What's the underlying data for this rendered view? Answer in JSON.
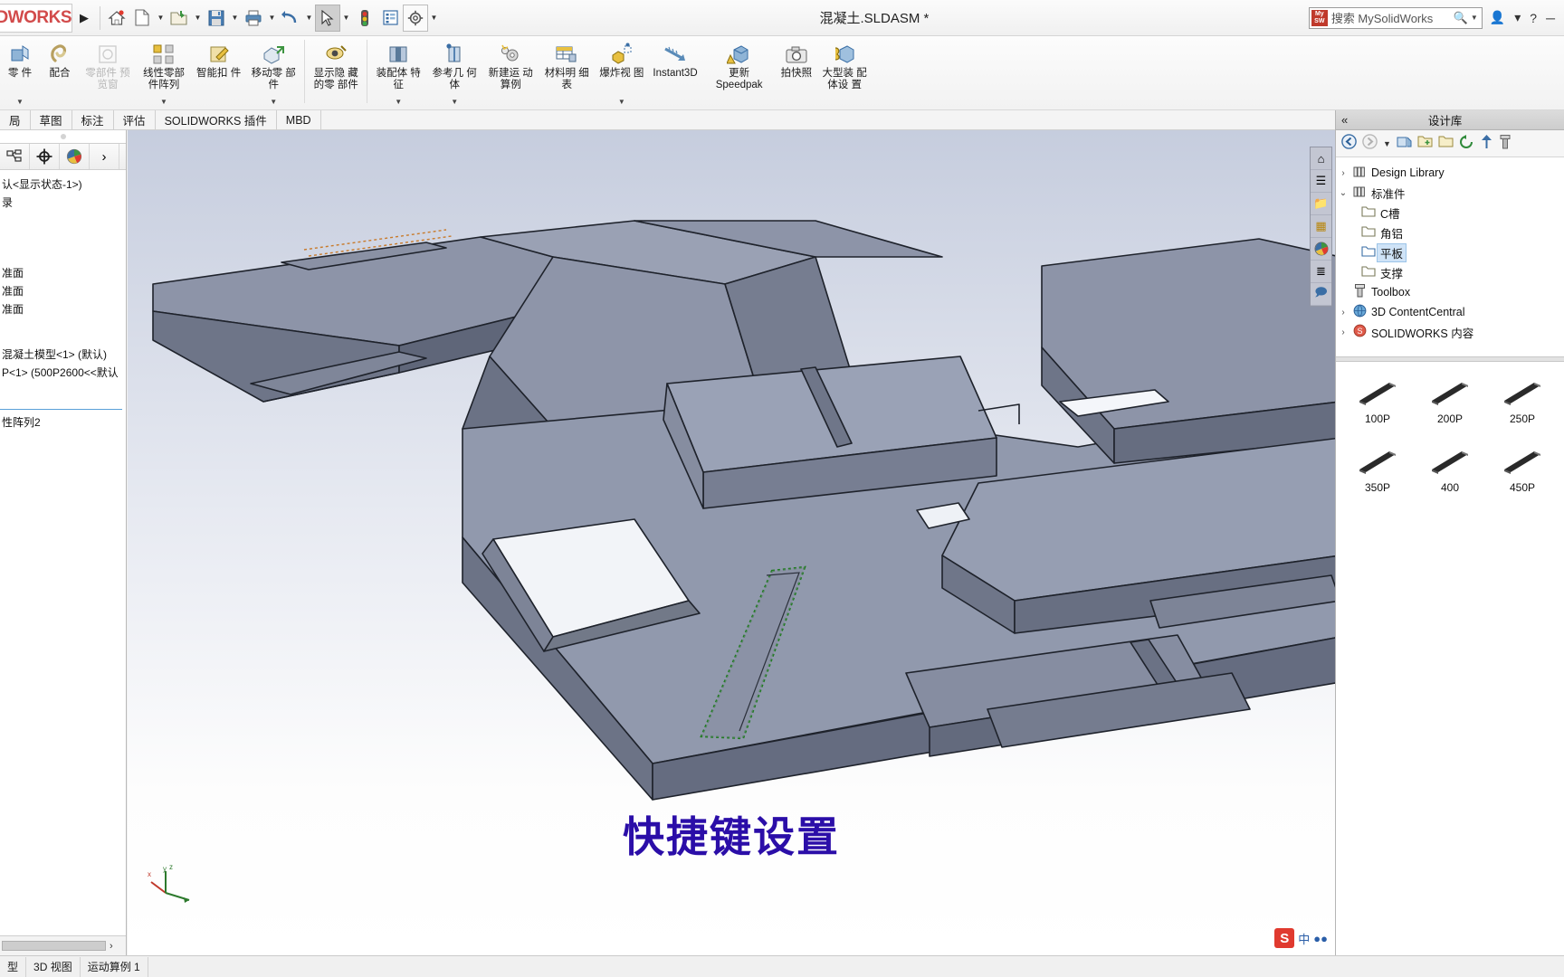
{
  "titlebar": {
    "logo": "DWORKS",
    "document_title": "混凝土.SLDASM *",
    "search": {
      "placeholder": "搜索 MySolidWorks",
      "badge": "My SW",
      "icon": "search-icon"
    },
    "quick_access": [
      {
        "name": "expand-arrow",
        "glyph": "▶",
        "caret": false
      },
      {
        "name": "home-icon",
        "glyph": "⌂",
        "caret": false
      },
      {
        "name": "new-document-icon",
        "glyph": "὜B",
        "caret": true
      },
      {
        "name": "open-folder-icon",
        "glyph": "Ὄ2",
        "caret": true
      },
      {
        "name": "save-icon",
        "glyph": "ὋE",
        "caret": true
      },
      {
        "name": "print-icon",
        "glyph": "὚8",
        "caret": true
      },
      {
        "name": "undo-icon",
        "glyph": "↶",
        "caret": true
      },
      {
        "name": "select-cursor-icon",
        "glyph": "➤",
        "caret": true
      },
      {
        "name": "traffic-light-icon",
        "glyph": "●",
        "caret": false
      },
      {
        "name": "options-list-icon",
        "glyph": "≣",
        "caret": false
      },
      {
        "name": "settings-gear-icon",
        "glyph": "⚙",
        "caret": true
      }
    ],
    "window_controls": [
      {
        "name": "help-dropdown",
        "glyph": "▾"
      },
      {
        "name": "account-icon",
        "glyph": "☺"
      },
      {
        "name": "help-icon",
        "glyph": "?"
      },
      {
        "name": "minimize-icon",
        "glyph": "─"
      }
    ]
  },
  "ribbon": {
    "groups": [
      {
        "items": [
          {
            "label": "零\n件",
            "icon": "insert-component-icon",
            "dropdown": true,
            "disabled": false,
            "truncated": true
          },
          {
            "label": "配合",
            "icon": "mate-icon",
            "dropdown": false,
            "disabled": false
          },
          {
            "label": "零部件\n预览窗",
            "icon": "component-preview-icon",
            "dropdown": false,
            "disabled": true
          },
          {
            "label": "线性零部\n件阵列",
            "icon": "linear-component-pattern-icon",
            "dropdown": true,
            "disabled": false
          },
          {
            "label": "智能扣\n件",
            "icon": "smart-fasteners-icon",
            "dropdown": false,
            "disabled": false
          },
          {
            "label": "移动零\n部件",
            "icon": "move-component-icon",
            "dropdown": true,
            "disabled": false
          }
        ]
      },
      {
        "items": [
          {
            "label": "显示隐\n藏的零\n部件",
            "icon": "show-hidden-components-icon",
            "dropdown": false,
            "disabled": false
          }
        ]
      },
      {
        "items": [
          {
            "label": "装配体\n特征",
            "icon": "assembly-features-icon",
            "dropdown": true,
            "disabled": false
          },
          {
            "label": "参考几\n何体",
            "icon": "reference-geometry-icon",
            "dropdown": true,
            "disabled": false
          },
          {
            "label": "新建运\n动算例",
            "icon": "new-motion-study-icon",
            "dropdown": false,
            "disabled": false
          },
          {
            "label": "材料明\n细表",
            "icon": "bill-of-materials-icon",
            "dropdown": false,
            "disabled": false
          },
          {
            "label": "爆炸视\n图",
            "icon": "exploded-view-icon",
            "dropdown": true,
            "disabled": false
          },
          {
            "label": "Instant3D",
            "icon": "instant3d-icon",
            "dropdown": false,
            "disabled": false
          },
          {
            "label": "更新\nSpeedpak",
            "icon": "update-speedpak-icon",
            "dropdown": false,
            "disabled": false
          },
          {
            "label": "拍快照",
            "icon": "take-snapshot-icon",
            "dropdown": false,
            "disabled": false
          },
          {
            "label": "大型装\n配体设\n置",
            "icon": "large-assembly-settings-icon",
            "dropdown": false,
            "disabled": false
          }
        ]
      }
    ]
  },
  "tabs": [
    {
      "label": "局",
      "active": false
    },
    {
      "label": "草图",
      "active": false
    },
    {
      "label": "标注",
      "active": false
    },
    {
      "label": "评估",
      "active": false
    },
    {
      "label": "SOLIDWORKS 插件",
      "active": false
    },
    {
      "label": "MBD",
      "active": false
    }
  ],
  "feature_panel": {
    "tabs": [
      {
        "name": "feature-manager-tab",
        "glyph": "⬚"
      },
      {
        "name": "property-manager-tab",
        "glyph": "⊕"
      },
      {
        "name": "display-manager-tab",
        "glyph": "◕"
      },
      {
        "name": "expand-panel-arrow",
        "glyph": "›"
      }
    ],
    "tree": [
      {
        "label": "认<显示状态-1>)",
        "indent": 0
      },
      {
        "label": "录",
        "indent": 0
      },
      {
        "label": "准面",
        "indent": 0,
        "gap": true
      },
      {
        "label": "准面",
        "indent": 0
      },
      {
        "label": "准面",
        "indent": 0
      },
      {
        "label": "混凝土模型<1> (默认)",
        "indent": 0,
        "biggap": true
      },
      {
        "label": "P<1> (500P2600<<默认",
        "indent": 0
      },
      {
        "label": "性阵列2",
        "indent": 0,
        "biggap": true
      }
    ]
  },
  "graphics": {
    "view_toolbar": [
      {
        "name": "zoom-to-fit-icon",
        "glyph": "⌗"
      },
      {
        "name": "zoom-area-icon",
        "glyph": "⌕"
      },
      {
        "name": "previous-view-icon",
        "glyph": "↶"
      },
      {
        "name": "section-view-icon",
        "glyph": "◧"
      },
      {
        "name": "view-orientation-icon",
        "glyph": "❑"
      },
      {
        "name": "display-style-icon",
        "glyph": "◓"
      },
      {
        "name": "hide-show-items-icon",
        "glyph": "◈"
      },
      {
        "name": "edit-appearance-icon",
        "glyph": "▣"
      },
      {
        "name": "apply-scene-icon",
        "glyph": "●"
      },
      {
        "name": "view-settings-icon",
        "glyph": "⚙"
      },
      {
        "name": "viewport-icon",
        "glyph": "▭"
      }
    ],
    "window_buttons": [
      {
        "name": "restore-left-icon",
        "glyph": "◀"
      },
      {
        "name": "restore-right-icon",
        "glyph": "▶"
      },
      {
        "name": "minimize-window-icon",
        "glyph": "─"
      },
      {
        "name": "restore-window-icon",
        "glyph": "❐"
      },
      {
        "name": "close-window-icon",
        "glyph": "✕"
      }
    ],
    "side_tools": [
      {
        "name": "view-home-icon",
        "glyph": "⌂"
      },
      {
        "name": "appearance-stack-icon",
        "glyph": "◰"
      },
      {
        "name": "folder-icon",
        "glyph": "὜0"
      },
      {
        "name": "decal-icon",
        "glyph": "▦"
      },
      {
        "name": "color-wheel-icon",
        "glyph": "●"
      },
      {
        "name": "display-list-icon",
        "glyph": "≣"
      },
      {
        "name": "comments-icon",
        "glyph": "὞9"
      }
    ],
    "overlay_caption": "快捷键设置",
    "triad_labels": {
      "x": "x",
      "y": "y",
      "z": "z"
    },
    "ime_badge": {
      "letter": "S",
      "text": "中"
    }
  },
  "design_library": {
    "panel_title": "设计库",
    "collapse_glyph": "«",
    "toolbar": [
      {
        "name": "back-icon",
        "glyph": "←"
      },
      {
        "name": "forward-icon",
        "glyph": "→"
      },
      {
        "name": "history-dropdown-icon",
        "glyph": "▾"
      },
      {
        "name": "add-to-library-icon",
        "glyph": "⊞"
      },
      {
        "name": "create-folder-icon",
        "glyph": "Ὄ1"
      },
      {
        "name": "open-folder-icon",
        "glyph": "Ὄ2"
      },
      {
        "name": "refresh-icon",
        "glyph": "↻"
      },
      {
        "name": "up-level-icon",
        "glyph": "↑"
      },
      {
        "name": "toolbox-icon",
        "glyph": "ὒ7"
      }
    ],
    "tree": [
      {
        "label": "Design Library",
        "indent": 0,
        "chevron": "›",
        "icon": "library-icon",
        "selected": false
      },
      {
        "label": "标准件",
        "indent": 0,
        "chevron": "⌄",
        "icon": "library-icon",
        "selected": false
      },
      {
        "label": "C槽",
        "indent": 1,
        "chevron": "",
        "icon": "folder-icon",
        "selected": false
      },
      {
        "label": "角铝",
        "indent": 1,
        "chevron": "",
        "icon": "folder-icon",
        "selected": false
      },
      {
        "label": "平板",
        "indent": 1,
        "chevron": "",
        "icon": "folder-icon",
        "selected": true
      },
      {
        "label": "支撑",
        "indent": 1,
        "chevron": "",
        "icon": "folder-icon",
        "selected": false
      },
      {
        "label": "Toolbox",
        "indent": 0,
        "chevron": "",
        "icon": "bolt-icon",
        "selected": false
      },
      {
        "label": "3D ContentCentral",
        "indent": 0,
        "chevron": "›",
        "icon": "globe-icon",
        "selected": false
      },
      {
        "label": "SOLIDWORKS 内容",
        "indent": 0,
        "chevron": "›",
        "icon": "sw-content-icon",
        "selected": false
      }
    ],
    "parts": [
      {
        "label": "100P",
        "icon": "plate-part-thumbnail"
      },
      {
        "label": "200P",
        "icon": "plate-part-thumbnail"
      },
      {
        "label": "250P",
        "icon": "plate-part-thumbnail"
      },
      {
        "label": "350P",
        "icon": "plate-part-thumbnail"
      },
      {
        "label": "400",
        "icon": "plate-part-thumbnail"
      },
      {
        "label": "450P",
        "icon": "plate-part-thumbnail"
      }
    ]
  },
  "statusbar": {
    "items": [
      {
        "label": "型"
      },
      {
        "label": "3D 视图"
      },
      {
        "label": "运动算例 1"
      }
    ]
  },
  "colors": {
    "accent_blue": "#2b0ea8",
    "selection_blue": "#cfe3f7",
    "sw_red": "#d24b4b",
    "model_face_light": "#9aa0b4",
    "model_face_mid": "#7b8196",
    "model_face_dark": "#5f6578"
  }
}
